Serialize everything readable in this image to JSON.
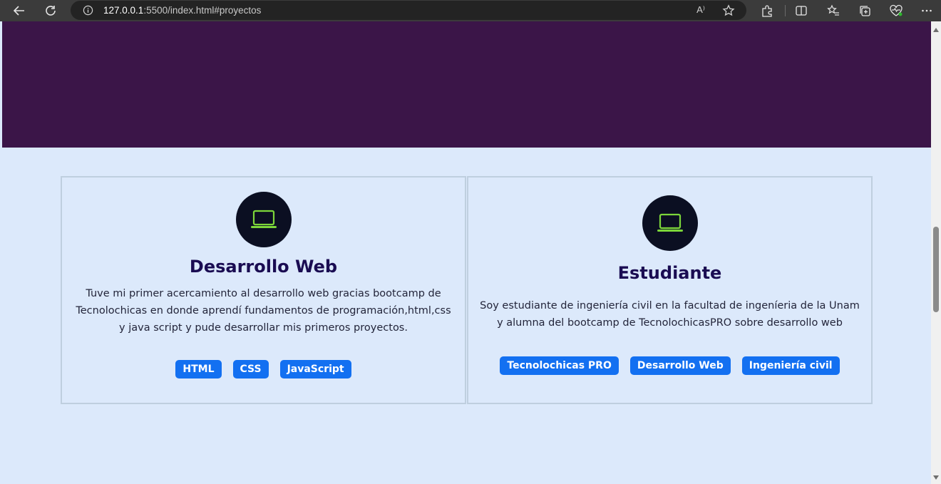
{
  "browser": {
    "url_host": "127.0.0.1",
    "url_path": ":5500/index.html#proyectos",
    "read_aloud_label": "A⁾"
  },
  "cards": [
    {
      "title": "Desarrollo Web",
      "description": "Tuve mi primer acercamiento al desarrollo web gracias bootcamp de Tecnolochicas en donde aprendí fundamentos de programación,html,css y java script y pude desarrollar mis primeros proyectos.",
      "tags": [
        "HTML",
        "CSS",
        "JavaScript"
      ]
    },
    {
      "title": "Estudiante",
      "description": "Soy estudiante de ingeniería civil en la facultad de ingeníeria de la Unam y alumna del bootcamp de TecnolochicasPRO sobre desarrollo web",
      "tags": [
        "Tecnolochicas PRO",
        "Desarrollo Web",
        "Ingeniería civil"
      ]
    }
  ],
  "colors": {
    "hero_bg": "#3b1548",
    "content_bg": "#dce9fb",
    "icon_circle": "#0b0f22",
    "icon_green": "#7cd63a",
    "title": "#1a0c52",
    "tag_bg": "#1370f1"
  },
  "icons": {
    "card_icon": "laptop-icon"
  }
}
